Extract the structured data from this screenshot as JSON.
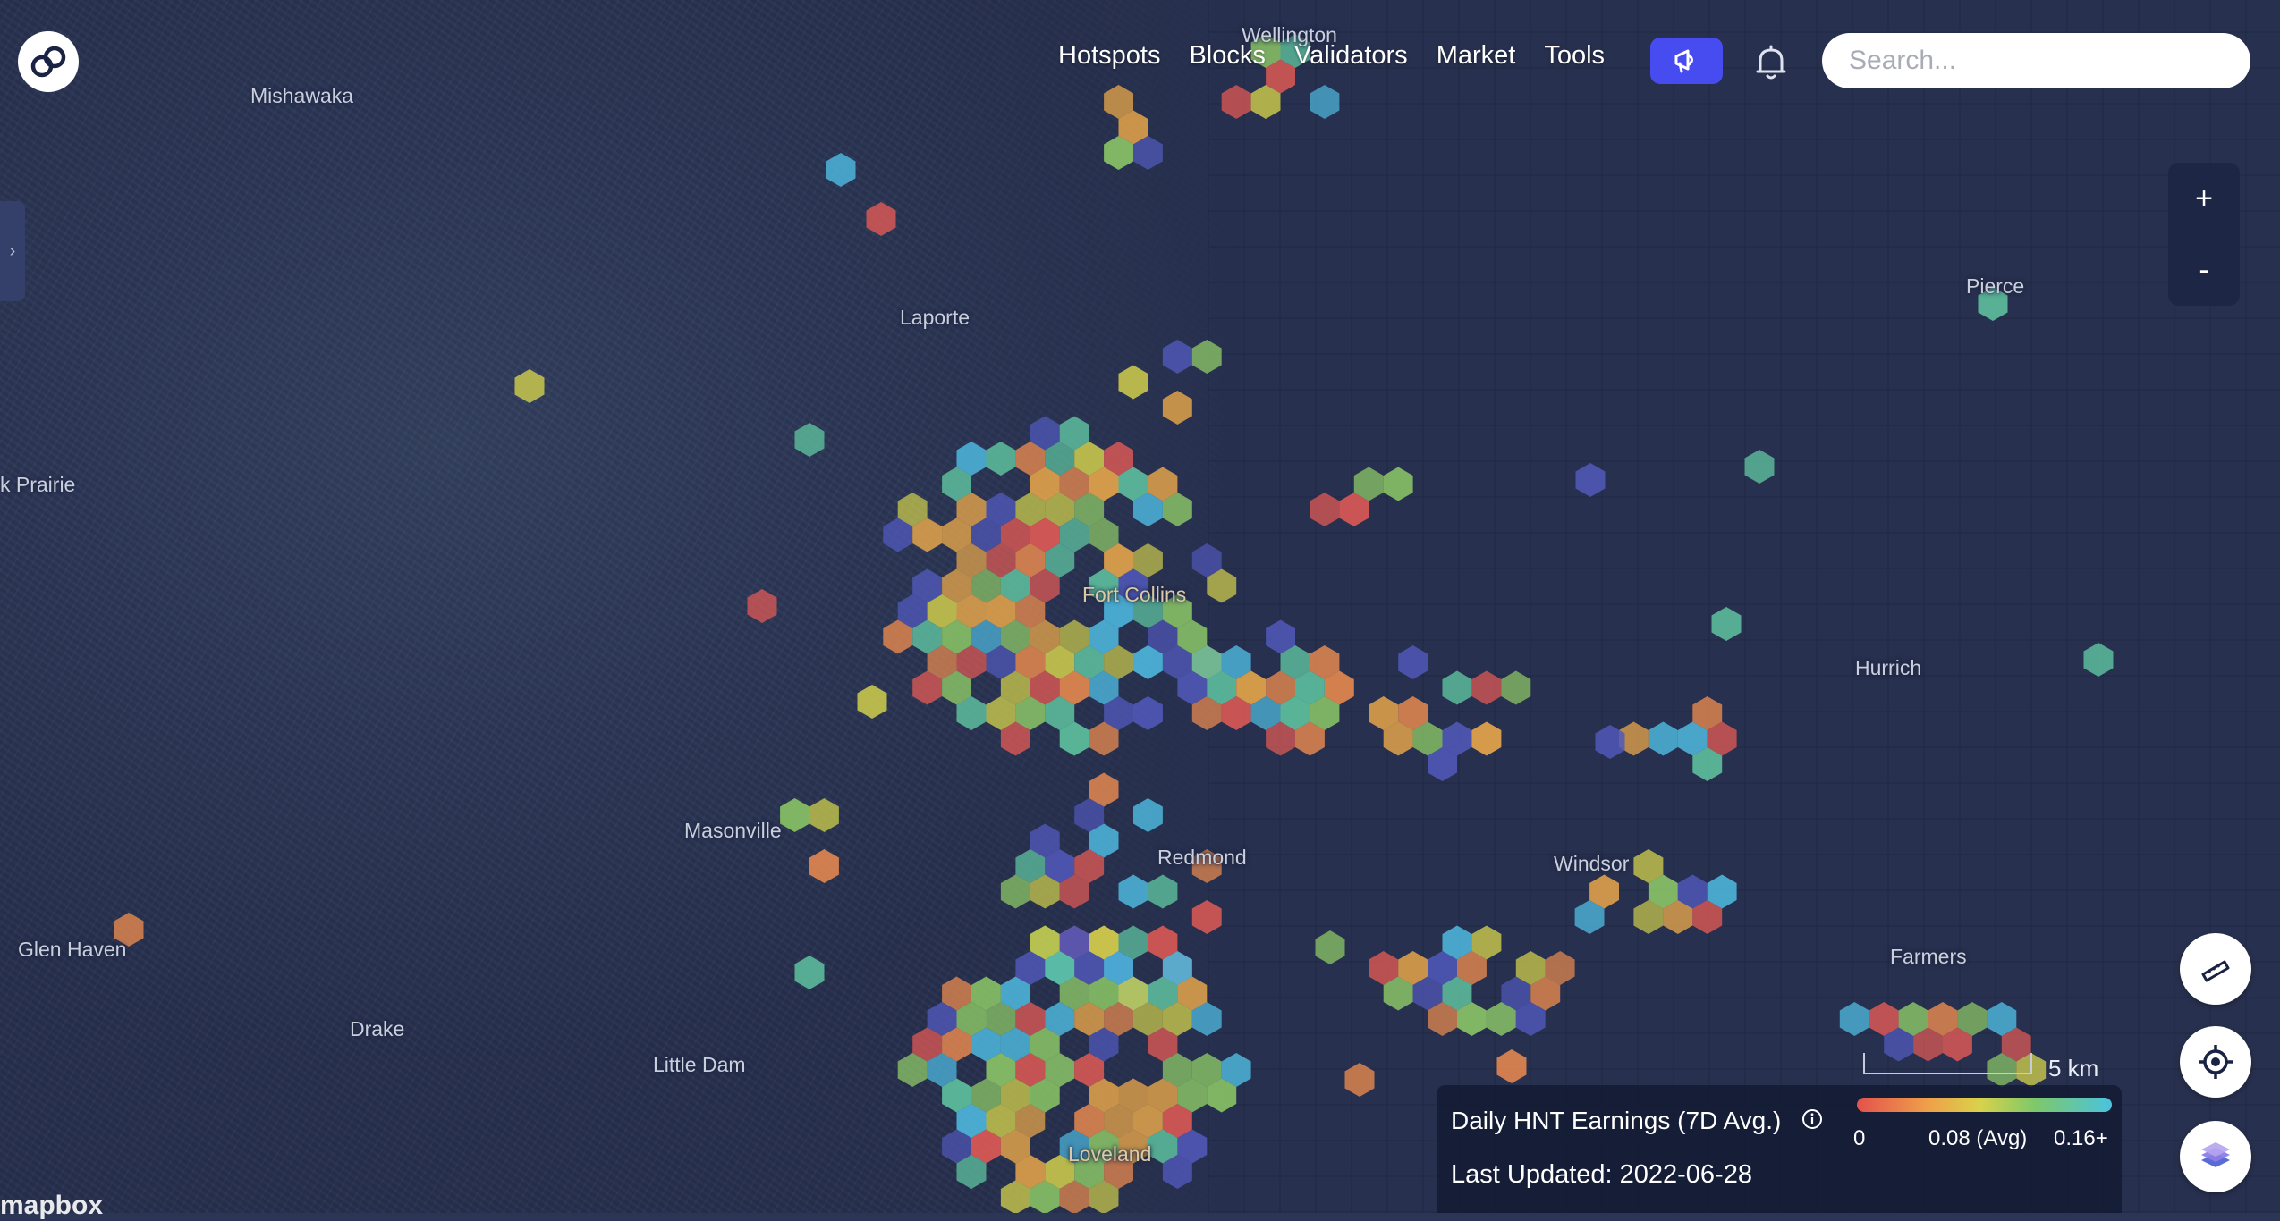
{
  "nav": {
    "items": [
      "Hotspots",
      "Blocks",
      "Validators",
      "Market",
      "Tools"
    ],
    "search_placeholder": "Search..."
  },
  "map_labels": [
    {
      "name": "Wellington"
    },
    {
      "name": "Mishawaka"
    },
    {
      "name": "Laporte"
    },
    {
      "name": "Pierce"
    },
    {
      "name": "k Prairie"
    },
    {
      "name": "Fort Collins"
    },
    {
      "name": "Hurrich"
    },
    {
      "name": "Masonville"
    },
    {
      "name": "Redmond"
    },
    {
      "name": "Windsor"
    },
    {
      "name": "Glen Haven"
    },
    {
      "name": "Farmers"
    },
    {
      "name": "Drake"
    },
    {
      "name": "Little Dam"
    },
    {
      "name": "Loveland"
    }
  ],
  "zoom": {
    "in": "+",
    "out": "-"
  },
  "scale": {
    "label": "5 km"
  },
  "legend": {
    "title": "Daily HNT Earnings (7D Avg.)",
    "min": "0",
    "avg": "0.08 (Avg)",
    "max": "0.16+",
    "updated": "Last Updated: 2022-06-28"
  },
  "attribution": "mapbox",
  "colors": {
    "hex_palette": [
      "#e05a55",
      "#e98a4f",
      "#e9a74a",
      "#c9c84c",
      "#8cc767",
      "#5fc3a0",
      "#4eb7dd",
      "#5058b8"
    ],
    "accent": "#474cf0"
  },
  "icons": {
    "logo": "helium-logo-icon",
    "announce": "megaphone-icon",
    "bell": "bell-icon",
    "ruler": "ruler-icon",
    "locate": "crosshair-icon",
    "layers": "layers-icon",
    "info": "info-icon"
  }
}
